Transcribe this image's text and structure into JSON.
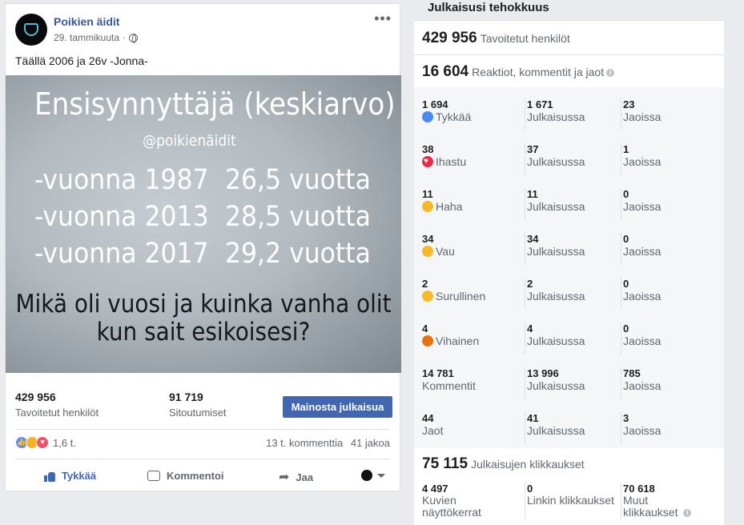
{
  "post": {
    "page_name": "Poikien äidit",
    "date": "29. tammikuuta",
    "text": "Täällä 2006 ja 26v -Jonna-",
    "image": {
      "title": "Ensisynnyttäjä (keskiarvo)",
      "handle": "@poikienäidit",
      "rows": [
        {
          "year": "-vuonna 1987",
          "age": "26,5 vuotta"
        },
        {
          "year": "-vuonna 2013",
          "age": "28,5 vuotta"
        },
        {
          "year": "-vuonna 2017",
          "age": "29,2 vuotta"
        }
      ],
      "question_line1": "Mikä oli vuosi ja kuinka vanha olit",
      "question_line2": "kun sait esikoisesi?"
    },
    "reached_value": "429 956",
    "reached_label": "Tavoitetut henkilöt",
    "engagement_value": "91 719",
    "engagement_label": "Sitoutumiset",
    "boost_label": "Mainosta julkaisua",
    "reaction_count": "1,6 t.",
    "comments": "13 t. kommenttia",
    "shares": "41 jakoa",
    "actions": {
      "like": "Tykkää",
      "comment": "Kommentoi",
      "share": "Jaa"
    }
  },
  "insights": {
    "title": "Julkaisusi tehokkuus",
    "reach_value": "429 956",
    "reach_label": "Tavoitetut henkilöt",
    "engagement_value": "16 604",
    "engagement_label": "Reaktiot, kommentit ja jaot",
    "rows": [
      {
        "icon": "like-emoji-icon",
        "total": "1 694",
        "label": "Tykkää",
        "on_post": "1 671",
        "on_post_label": "Julkaisussa",
        "shares": "23",
        "shares_label": "Jaoissa"
      },
      {
        "icon": "love-emoji-icon",
        "total": "38",
        "label": "Ihastu",
        "on_post": "37",
        "on_post_label": "Julkaisussa",
        "shares": "1",
        "shares_label": "Jaoissa"
      },
      {
        "icon": "haha-emoji-icon",
        "total": "11",
        "label": "Haha",
        "on_post": "11",
        "on_post_label": "Julkaisussa",
        "shares": "0",
        "shares_label": "Jaoissa"
      },
      {
        "icon": "wow-emoji-icon",
        "total": "34",
        "label": "Vau",
        "on_post": "34",
        "on_post_label": "Julkaisussa",
        "shares": "0",
        "shares_label": "Jaoissa"
      },
      {
        "icon": "sad-emoji-icon",
        "total": "2",
        "label": "Surullinen",
        "on_post": "2",
        "on_post_label": "Julkaisussa",
        "shares": "0",
        "shares_label": "Jaoissa"
      },
      {
        "icon": "angry-emoji-icon",
        "total": "4",
        "label": "Vihainen",
        "on_post": "4",
        "on_post_label": "Julkaisussa",
        "shares": "0",
        "shares_label": "Jaoissa"
      },
      {
        "icon": "",
        "total": "14 781",
        "label": "Kommentit",
        "on_post": "13 996",
        "on_post_label": "Julkaisussa",
        "shares": "785",
        "shares_label": "Jaoissa"
      },
      {
        "icon": "",
        "total": "44",
        "label": "Jaot",
        "on_post": "41",
        "on_post_label": "Julkaisussa",
        "shares": "3",
        "shares_label": "Jaoissa"
      }
    ],
    "clicks_value": "75 115",
    "clicks_label": "Julkaisujen klikkaukset",
    "clicks": [
      {
        "value": "4 497",
        "label_line1": "Kuvien",
        "label_line2": "näyttökerrat"
      },
      {
        "value": "0",
        "label_line1": "Linkin klikkaukset",
        "label_line2": ""
      },
      {
        "value": "70 618",
        "label_line1": "Muut",
        "label_line2": "klikkaukset"
      }
    ]
  },
  "colors": {
    "link": "#385898",
    "button": "#4267b2",
    "love": "#f0284a",
    "haha_wow_sad": "#f7b928",
    "angry": "#e9710f",
    "background": "#e9ebee"
  }
}
